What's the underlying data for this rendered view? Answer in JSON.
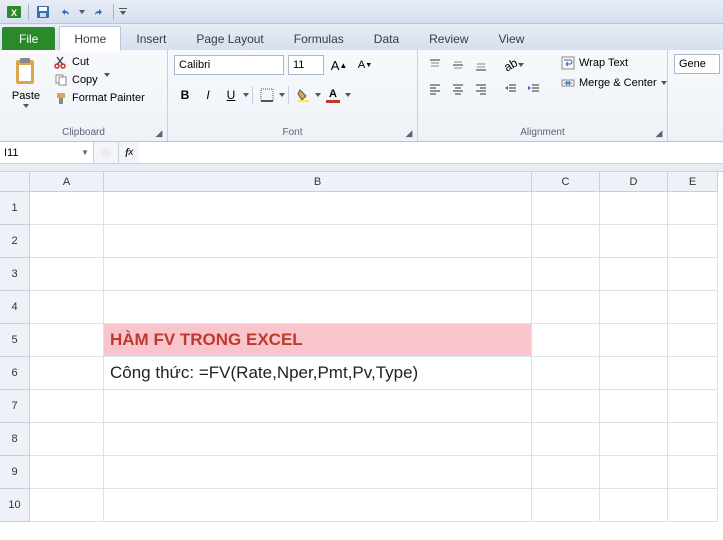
{
  "qat": {
    "save": "save",
    "undo": "undo",
    "redo": "redo"
  },
  "tabs": {
    "file": "File",
    "items": [
      "Home",
      "Insert",
      "Page Layout",
      "Formulas",
      "Data",
      "Review",
      "View"
    ],
    "active": 0
  },
  "ribbon": {
    "clipboard": {
      "label": "Clipboard",
      "paste": "Paste",
      "cut": "Cut",
      "copy": "Copy",
      "format_painter": "Format Painter"
    },
    "font": {
      "label": "Font",
      "name": "Calibri",
      "size": "11"
    },
    "alignment": {
      "label": "Alignment",
      "wrap": "Wrap Text",
      "merge": "Merge & Center"
    },
    "number_partial": "Gene"
  },
  "name_box": "I11",
  "formula_bar": "",
  "columns": [
    "A",
    "B",
    "C",
    "D",
    "E"
  ],
  "rows": [
    "1",
    "2",
    "3",
    "4",
    "5",
    "6",
    "7",
    "8",
    "9",
    "10"
  ],
  "cells": {
    "B5": "HÀM FV TRONG EXCEL",
    "B6": "Công thức: =FV(Rate,Nper,Pmt,Pv,Type)"
  }
}
